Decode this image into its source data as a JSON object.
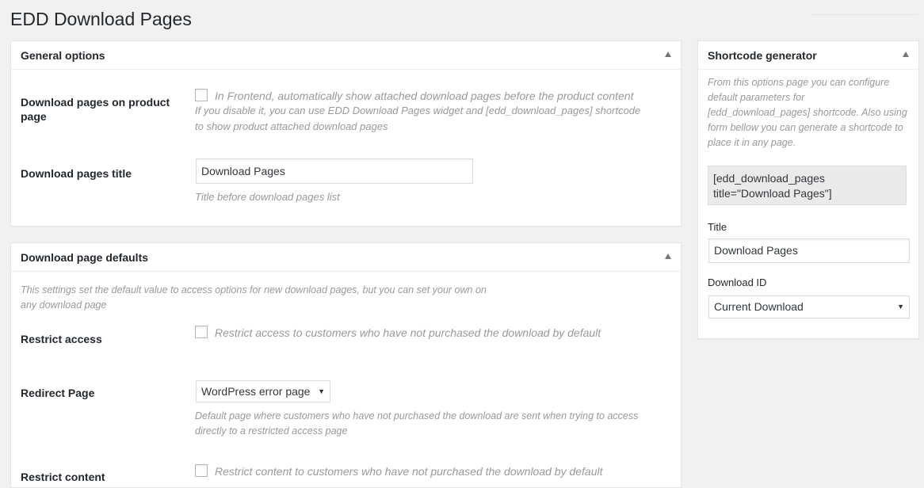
{
  "page": {
    "title": "EDD Download Pages"
  },
  "general": {
    "title": "General options",
    "download_pages_label": "Download pages on product page",
    "frontend_checkbox_label": "In Frontend, automatically show attached download pages before the product content",
    "frontend_desc_line1": "If you disable it, you can use EDD Download Pages widget and [edd_download_pages] shortcode",
    "frontend_desc_line2": "to show product attached download pages",
    "title_label": "Download pages title",
    "title_value": "Download Pages",
    "title_desc": "Title before download pages list"
  },
  "defaults": {
    "title": "Download page defaults",
    "intro_line1": "This settings set the default value to access options for new download pages, but you can set your own on",
    "intro_line2": "any download page",
    "restrict_access_label": "Restrict access",
    "restrict_access_checkbox": "Restrict access to customers who have not purchased the download by default",
    "redirect_label": "Redirect Page",
    "redirect_value": "WordPress error page",
    "redirect_desc_line1": "Default page where customers who have not purchased the download are sent when trying to access",
    "redirect_desc_line2": "directly to a restricted access page",
    "restrict_content_label": "Restrict content",
    "restrict_content_checkbox": "Restrict content to customers who have not purchased the download by default"
  },
  "shortcode": {
    "title": "Shortcode generator",
    "desc_lines": [
      "From this options page you can configure",
      "default parameters for",
      "[edd_download_pages] shortcode. Also using",
      "form bellow you can generate a shortcode to",
      "place it in any page."
    ],
    "code_line1": "[edd_download_pages",
    "code_line2": "title=\"Download Pages\"]",
    "title_label": "Title",
    "title_value": "Download Pages",
    "download_id_label": "Download ID",
    "download_id_value": "Current Download"
  },
  "icons": {
    "toggle": "triangle-up-icon",
    "select_caret": "caret-down-icon"
  }
}
